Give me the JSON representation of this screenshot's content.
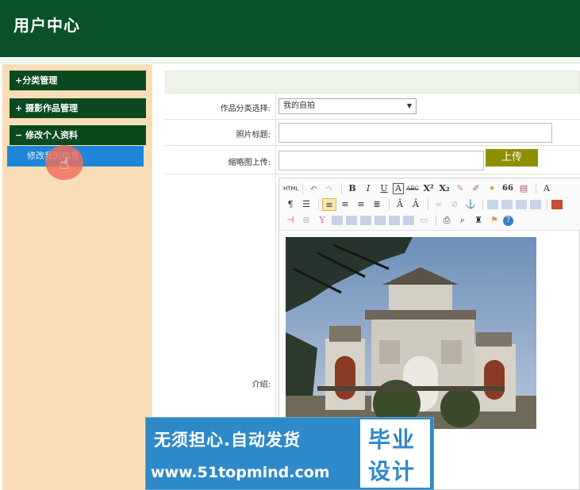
{
  "header": {
    "title": "用户中心"
  },
  "sidebar": {
    "groups": [
      {
        "label": "+分类管理"
      },
      {
        "label": "+ 摄影作品管理"
      },
      {
        "label": "− 修改个人资料"
      }
    ],
    "active_item": {
      "label": "修改我的信息"
    }
  },
  "form": {
    "category": {
      "label": "作品分类选择:",
      "selected": "我的自拍"
    },
    "title": {
      "label": "照片标题:",
      "value": ""
    },
    "thumbnail": {
      "label": "缩略图上传:",
      "value": "",
      "upload_button": "上传"
    },
    "intro": {
      "label": "介绍:"
    }
  },
  "editor": {
    "toolbar_icons": [
      "html-icon",
      "undo-icon",
      "redo-icon",
      "bold-icon",
      "italic-icon",
      "underline-icon",
      "fontborder-icon",
      "strikethrough-icon",
      "superscript-icon",
      "subscript-icon",
      "removeformat-icon",
      "formatmatch-icon",
      "autotypeset-icon",
      "blockquote-icon",
      "pasteplain-icon",
      "forecolor-icon"
    ],
    "toolbar_labels": {
      "html": "HTML",
      "bold": "B",
      "italic": "I",
      "underline": "U",
      "fontborder": "A",
      "strike": "ABC",
      "sup": "X²",
      "sub": "X₂",
      "quote": "66",
      "forecolor": "A"
    }
  },
  "watermark": {
    "line1": "无须担心.自动发货",
    "line2": "www.51topmind.com",
    "box_line1": "毕业",
    "box_line2": "设计"
  },
  "colors": {
    "header_bg": "#0b5229",
    "sidebar_bg": "#f7deb8",
    "menu_head_bg": "#0b4a1f",
    "active_item_bg": "#1d86d8",
    "upload_button_bg": "#8f8e00",
    "watermark_bg": "#2e89c8"
  }
}
